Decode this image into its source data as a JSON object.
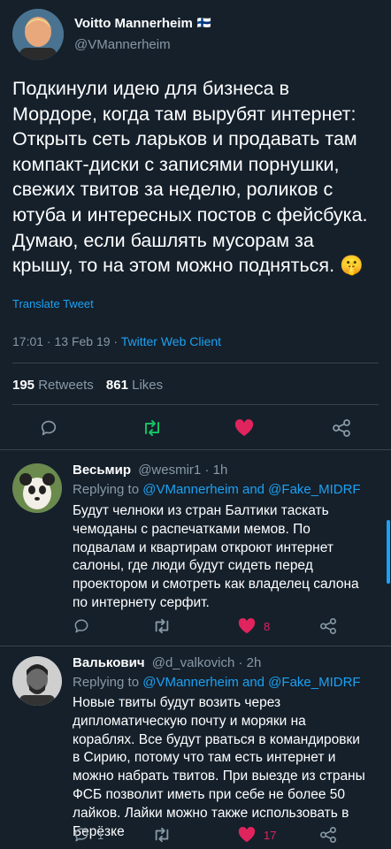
{
  "author": {
    "name": "Voitto Mannerheim",
    "flag": "🇫🇮",
    "handle": "@VMannerheim"
  },
  "tweet": {
    "text": "Подкинули идею для бизнеса в Мордоре, когда там вырубят интернет: Открыть сеть ларьков и продавать там компакт-диски с записями порнушки, свежих твитов за неделю, роликов с ютуба и интересных постов с фейсбука. Думаю, если башлять мусорам за крышу, то на этом можно подняться.",
    "emoji": "🤫",
    "translate_label": "Translate Tweet",
    "time": "17:01 · 13 Feb 19 ·",
    "client": "Twitter Web Client",
    "retweets_count": "195",
    "retweets_label": "Retweets",
    "likes_count": "861",
    "likes_label": "Likes"
  },
  "colors": {
    "background": "#15202b",
    "accent": "#1da1f2",
    "muted": "#8899a6",
    "retweet_green": "#17bf63",
    "like_red": "#e0245e",
    "divider": "#38444d"
  },
  "replies": [
    {
      "name": "Весьмир",
      "handle": "@wesmir1 · 1h",
      "replying_prefix": "Replying to",
      "replying_to": "@VMannerheim and @Fake_MIDRF",
      "text": "Будут челноки из стран Балтики таскать чемоданы с распечатками мемов. По подвалам и квартирам откроют интернет салоны, где люди будут сидеть перед проектором и смотреть как владелец салона по интернету серфит.",
      "reply_count": "",
      "like_count": "8"
    },
    {
      "name": "Валькович",
      "handle": "@d_valkovich · 2h",
      "replying_prefix": "Replying to",
      "replying_to": "@VMannerheim and @Fake_MIDRF",
      "text": "Новые твиты будут возить через дипломатическую почту и моряки на кораблях. Все будут рваться в командировки в Сирию, потому что там есть интернет и можно набрать твитов. При выезде из страны ФСБ позволит иметь при себе не более 50 лайков. Лайки можно также использовать в Берёзке",
      "reply_count": "1",
      "like_count": "17"
    }
  ]
}
